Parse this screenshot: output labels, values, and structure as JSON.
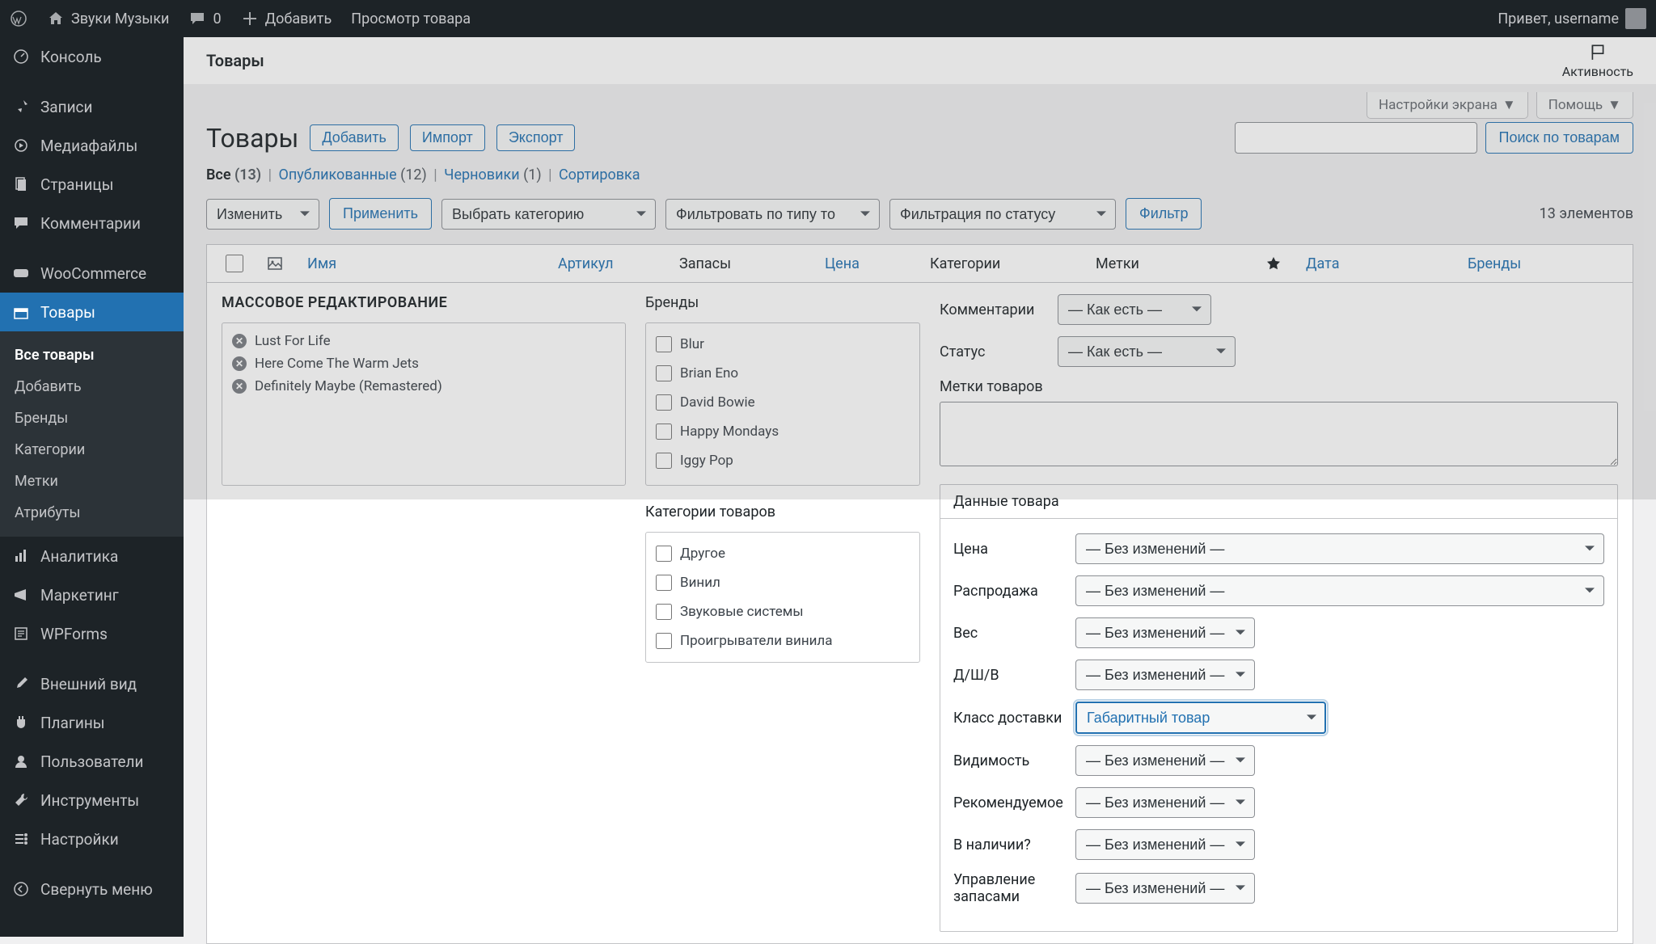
{
  "adminbar": {
    "site_name": "Звуки Музыки",
    "comments_count": "0",
    "add_new": "Добавить",
    "view_product": "Просмотр товара",
    "greeting": "Привет, username"
  },
  "sidebar": {
    "items": [
      {
        "label": "Консоль"
      },
      {
        "label": "Записи"
      },
      {
        "label": "Медиафайлы"
      },
      {
        "label": "Страницы"
      },
      {
        "label": "Комментарии"
      },
      {
        "label": "WooCommerce"
      },
      {
        "label": "Товары"
      },
      {
        "label": "Аналитика"
      },
      {
        "label": "Маркетинг"
      },
      {
        "label": "WPForms"
      },
      {
        "label": "Внешний вид"
      },
      {
        "label": "Плагины"
      },
      {
        "label": "Пользователи"
      },
      {
        "label": "Инструменты"
      },
      {
        "label": "Настройки"
      },
      {
        "label": "Свернуть меню"
      }
    ],
    "submenu": [
      {
        "label": "Все товары"
      },
      {
        "label": "Добавить"
      },
      {
        "label": "Бренды"
      },
      {
        "label": "Категории"
      },
      {
        "label": "Метки"
      },
      {
        "label": "Атрибуты"
      }
    ]
  },
  "header": {
    "title": "Товары",
    "activity": "Активность"
  },
  "screen_options": {
    "options_btn": "Настройки экрана",
    "help_btn": "Помощь"
  },
  "page": {
    "heading": "Товары",
    "add_btn": "Добавить",
    "import_btn": "Импорт",
    "export_btn": "Экспорт"
  },
  "subsubsub": {
    "all_label": "Все",
    "all_count": "(13)",
    "published_label": "Опубликованные",
    "published_count": "(12)",
    "drafts_label": "Черновики",
    "drafts_count": "(1)",
    "sort_label": "Сортировка"
  },
  "actions": {
    "bulk_action": "Изменить",
    "apply_btn": "Применить",
    "filter_category": "Выбрать категорию",
    "filter_type": "Фильтровать по типу то",
    "filter_status": "Фильтрация по статусу",
    "filter_btn": "Фильтр",
    "items_count": "13 элементов",
    "search_btn": "Поиск по товарам"
  },
  "table": {
    "headers": {
      "name": "Имя",
      "sku": "Артикул",
      "stock": "Запасы",
      "price": "Цена",
      "categories": "Категории",
      "tags": "Метки",
      "date": "Дата",
      "brands": "Бренды"
    }
  },
  "bulk": {
    "title": "МАССОВОЕ РЕДАКТИРОВАНИЕ",
    "selected_items": [
      "Lust For Life",
      "Here Come The Warm Jets",
      "Definitely Maybe (Remastered)"
    ],
    "brands_label": "Бренды",
    "brands_options": [
      "Blur",
      "Brian Eno",
      "David Bowie",
      "Happy Mondays",
      "Iggy Pop"
    ],
    "categories_label": "Категории товаров",
    "categories_options": [
      "Другое",
      "Винил",
      "Звуковые системы",
      "Проигрыватели винила"
    ],
    "comments_label": "Комментарии",
    "comments_value": "— Как есть —",
    "status_label": "Статус",
    "status_value": "— Как есть —",
    "tags_label": "Метки товаров"
  },
  "product_data": {
    "box_title": "Данные товара",
    "rows": {
      "price": {
        "label": "Цена",
        "value": "— Без изменений —"
      },
      "sale": {
        "label": "Распродажа",
        "value": "— Без изменений —"
      },
      "weight": {
        "label": "Вес",
        "value": "— Без изменений —"
      },
      "dims": {
        "label": "Д/Ш/В",
        "value": "— Без изменений —"
      },
      "shipping_class": {
        "label": "Класс доставки",
        "value": "Габаритный товар"
      },
      "visibility": {
        "label": "Видимость",
        "value": "— Без изменений —"
      },
      "featured": {
        "label": "Рекомендуемое",
        "value": "— Без изменений —"
      },
      "in_stock": {
        "label": "В наличии?",
        "value": "— Без изменений —"
      },
      "manage_stock": {
        "label": "Управление запасами",
        "value": "— Без изменений —"
      }
    }
  }
}
